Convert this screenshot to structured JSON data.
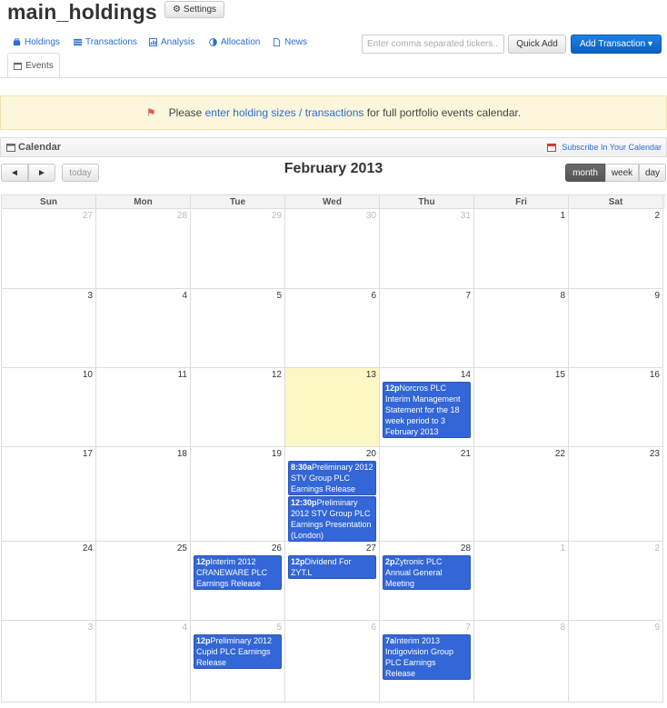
{
  "app": {
    "title": "main_holdings",
    "settings_label": "Settings"
  },
  "tabs": [
    {
      "label": "Holdings",
      "icon": "holdings-icon"
    },
    {
      "label": "Transactions",
      "icon": "list-icon"
    },
    {
      "label": "Analysis",
      "icon": "chart-icon"
    },
    {
      "label": "Allocation",
      "icon": "pie-icon"
    },
    {
      "label": "News",
      "icon": "document-icon"
    },
    {
      "label": "Events",
      "icon": "calendar-icon"
    }
  ],
  "toolbar": {
    "tickers_placeholder": "Enter comma separated tickers...",
    "quick_add_label": "Quick Add",
    "add_transaction_label": "Add Transaction ▾"
  },
  "alert": {
    "prefix": "Please ",
    "link": "enter holding sizes / transactions",
    "suffix": " for full portfolio events calendar."
  },
  "calendar": {
    "panel_title": "Calendar",
    "subscribe_label": "Subscribe In Your Calendar",
    "prev_label": "◄",
    "next_label": "►",
    "today_label": "today",
    "month_title": "February 2013",
    "views": [
      "month",
      "week",
      "day"
    ],
    "active_view": "month",
    "weekdays": [
      "Sun",
      "Mon",
      "Tue",
      "Wed",
      "Thu",
      "Fri",
      "Sat"
    ],
    "weeks": [
      [
        {
          "d": "27",
          "o": 1
        },
        {
          "d": "28",
          "o": 1
        },
        {
          "d": "29",
          "o": 1
        },
        {
          "d": "30",
          "o": 1
        },
        {
          "d": "31",
          "o": 1
        },
        {
          "d": "1"
        },
        {
          "d": "2"
        }
      ],
      [
        {
          "d": "3"
        },
        {
          "d": "4"
        },
        {
          "d": "5"
        },
        {
          "d": "6"
        },
        {
          "d": "7"
        },
        {
          "d": "8"
        },
        {
          "d": "9"
        }
      ],
      [
        {
          "d": "10"
        },
        {
          "d": "11"
        },
        {
          "d": "12"
        },
        {
          "d": "13",
          "today": 1
        },
        {
          "d": "14",
          "events": [
            {
              "time": "12p",
              "title": "Norcros PLC Interim Management Statement for the 18 week period to 3 February 2013"
            }
          ]
        },
        {
          "d": "15"
        },
        {
          "d": "16"
        }
      ],
      [
        {
          "d": "17"
        },
        {
          "d": "18"
        },
        {
          "d": "19"
        },
        {
          "d": "20",
          "events": [
            {
              "time": "8:30a",
              "title": "Preliminary 2012 STV Group PLC Earnings Release"
            },
            {
              "time": "12:30p",
              "title": "Preliminary 2012 STV Group PLC Earnings Presentation (London)"
            }
          ]
        },
        {
          "d": "21"
        },
        {
          "d": "22"
        },
        {
          "d": "23"
        }
      ],
      [
        {
          "d": "24"
        },
        {
          "d": "25"
        },
        {
          "d": "26",
          "events": [
            {
              "time": "12p",
              "title": "Interim 2012 CRANEWARE PLC Earnings Release"
            }
          ]
        },
        {
          "d": "27",
          "events": [
            {
              "time": "12p",
              "title": "Dividend For ZYT.L"
            }
          ]
        },
        {
          "d": "28",
          "events": [
            {
              "time": "2p",
              "title": "Zytronic PLC Annual General Meeting"
            }
          ]
        },
        {
          "d": "1",
          "o": 1
        },
        {
          "d": "2",
          "o": 1
        }
      ],
      [
        {
          "d": "3",
          "o": 1
        },
        {
          "d": "4",
          "o": 1
        },
        {
          "d": "5",
          "o": 1,
          "events": [
            {
              "time": "12p",
              "title": "Preliminary 2012 Cupid PLC Earnings Release"
            }
          ]
        },
        {
          "d": "6",
          "o": 1
        },
        {
          "d": "7",
          "o": 1,
          "events": [
            {
              "time": "7a",
              "title": "Interim 2013 Indigovision Group PLC Earnings Release"
            }
          ]
        },
        {
          "d": "8",
          "o": 1
        },
        {
          "d": "9",
          "o": 1
        }
      ]
    ]
  },
  "colors": {
    "accent": "#2a6ed8",
    "event_bg": "#3366d6",
    "today_bg": "#fcf8c4",
    "alert_bg": "#fcf6dc"
  }
}
